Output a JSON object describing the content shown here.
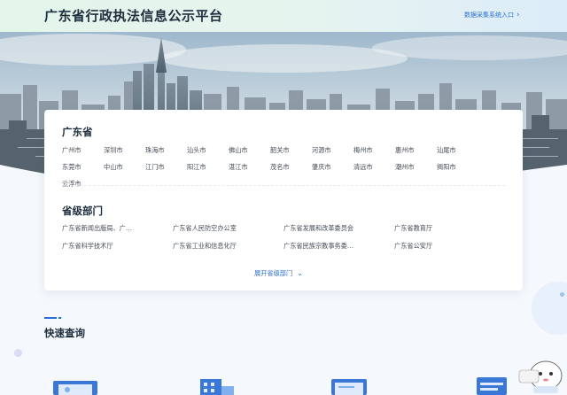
{
  "header": {
    "title": "广东省行政执法信息公示平台",
    "entry_link": "数据采集系统入口",
    "entry_chevron": "›"
  },
  "province": {
    "title": "广东省",
    "cities": [
      "广州市",
      "深圳市",
      "珠海市",
      "汕头市",
      "佛山市",
      "韶关市",
      "河源市",
      "梅州市",
      "惠州市",
      "汕尾市",
      "东莞市",
      "中山市",
      "江门市",
      "阳江市",
      "湛江市",
      "茂名市",
      "肇庆市",
      "清远市",
      "潮州市",
      "揭阳市",
      "云浮市"
    ]
  },
  "departments": {
    "title": "省级部门",
    "items": [
      "广东省新闻出版局、广…",
      "广东省人民防空办公室",
      "广东省发展和改革委员会",
      "广东省教育厅",
      "广东省科学技术厅",
      "广东省工业和信息化厅",
      "广东省民族宗教事务委…",
      "广东省公安厅"
    ],
    "expand_label": "展开省级部门",
    "expand_chevron": "⌄"
  },
  "quick_query": {
    "title": "快速查询"
  },
  "colors": {
    "accent": "#2b6fd6",
    "header_bg": "#e4f5ea",
    "text_dark": "#1e2d3d"
  }
}
